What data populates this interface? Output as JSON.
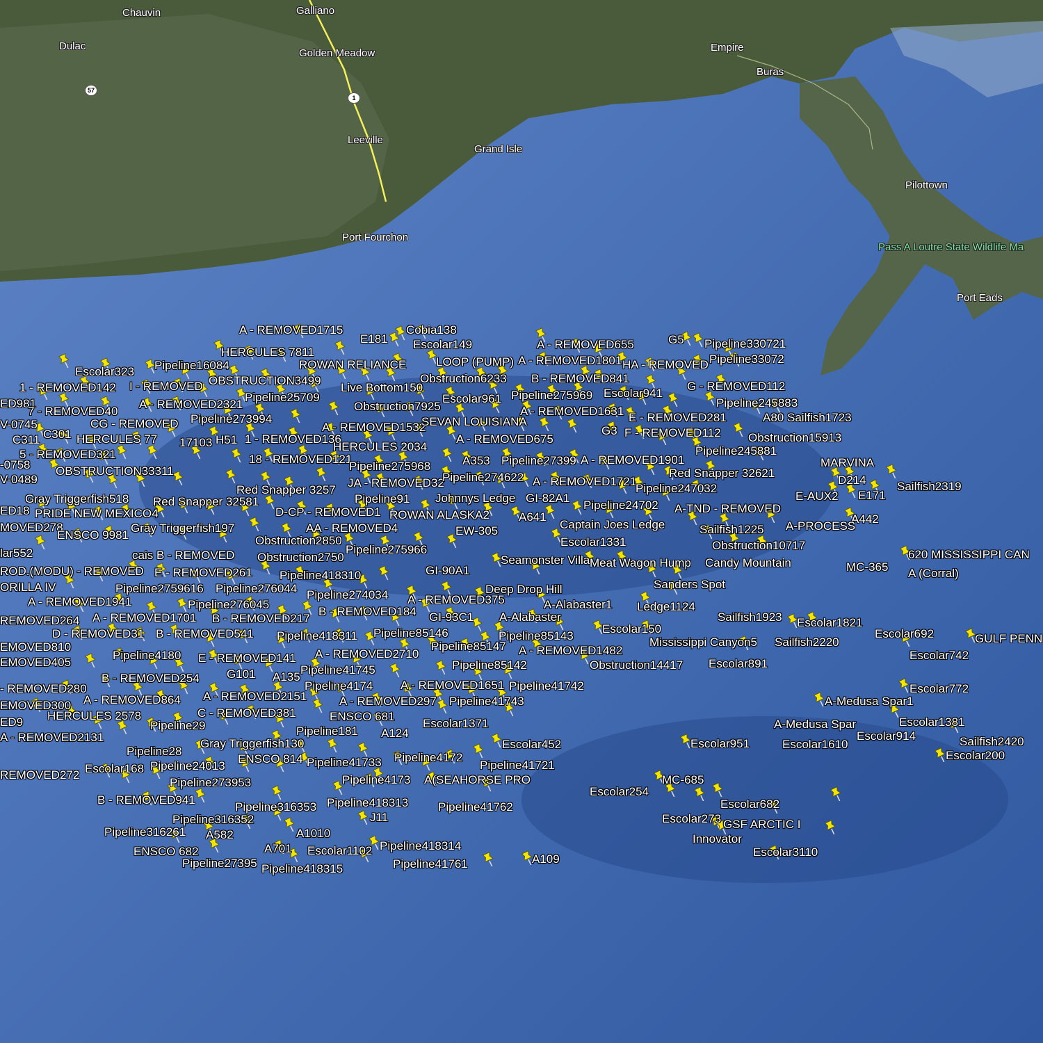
{
  "colors": {
    "pin": "#f2e600",
    "label": "#ffffff",
    "water": "#1e3d7a",
    "land": "#45573a",
    "highway": "#f4ef5a"
  },
  "places": [
    {
      "text": "Chauvin",
      "park": false
    },
    {
      "text": "Galliano",
      "park": false
    },
    {
      "text": "Dulac",
      "park": false
    },
    {
      "text": "Golden Meadow",
      "park": false
    },
    {
      "text": "Empire",
      "park": false
    },
    {
      "text": "Buras",
      "park": false
    },
    {
      "text": "Leeville",
      "park": false
    },
    {
      "text": "Grand Isle",
      "park": false
    },
    {
      "text": "Pilottown",
      "park": false
    },
    {
      "text": "Port Fourchon",
      "park": false
    },
    {
      "text": "Pass A Loutre State Wildlife Ma",
      "park": true
    },
    {
      "text": "Port Eads",
      "park": false
    }
  ],
  "highways": [
    "57",
    "1"
  ],
  "labels": [
    "A - REMOVED1715",
    "E181",
    "Cobia138",
    "Escolar149",
    "A - REMOVED655",
    "G5",
    "Pipeline330721",
    "HERCULES 7811",
    "ROWAN RELIANCE",
    "LOOP (PUMP)",
    "A - REMOVED1801",
    "HA - REMOVED",
    "Pipeline33072",
    "Escolar323",
    "Pipeline16084",
    "OBSTRUCTION3499",
    "Live Bottom150",
    "Obstruction6233",
    "B - REMOVED841",
    "1 - REMOVED142",
    "I - REMOVED",
    "G - REMOVED112",
    "Pipeline25709",
    "Escolar961",
    "Pipeline275969",
    "Escolar941",
    "ED981",
    "A - REMOVED2321",
    "Obstruction7925",
    "Pipeline245883",
    "7 - REMOVED40",
    "A - REMOVED1631",
    "A80",
    "Sailfish1723",
    "V-0745",
    "CG - REMOVED",
    "Pipeline273994",
    "A - REMOVED1532",
    "SEVAN LOUISIANA",
    "E - REMOVED281",
    "C311",
    "C301",
    "HERCULES 77",
    "17103",
    "H51",
    "1 - REMOVED136",
    "G3",
    "F - REMOVED112",
    "Obstruction15913",
    "HERCULES 2034",
    "A - REMOVED675",
    "5 - REMOVED321",
    "Pipeline245881",
    "-0758",
    "18 - REMOVED121",
    "A353",
    "Pipeline27399",
    "A - REMOVED1901",
    "Pipeline275968",
    "MARVINA",
    "OBSTRUCTION33311",
    "Red Snapper 32621",
    "V-0489",
    "JA - REMOVED32",
    "Pipeline274622",
    "A - REMOVED1721",
    "D214",
    "Red Snapper 3257",
    "Sailfish2319",
    "Pipeline247032",
    "Pipeline91",
    "Gray Triggerfish518",
    "Johnnys Ledge",
    "GI-82A1",
    "E-AUX2",
    "E171",
    "Red Snapper 32581",
    "Pipeline24702",
    "A-TND - REMOVED",
    "ED18",
    "D-CP - REMOVED1",
    "ROWAN ALASKA2",
    "PRIDE NEW MEXICO4",
    "A641",
    "Captain Joes Ledge",
    "A442",
    "MOVED278",
    "AA - REMOVED4",
    "A-PROCESS",
    "Sailfish1225",
    "Gray Triggerfish197",
    "EW-305",
    "ENSCO 9981",
    "Escolar1331",
    "Obstruction2850",
    "Obstruction10717",
    "Pipeline275966",
    "lar552",
    "620 MISSISSIPPI CAN",
    "cais B - REMOVED",
    "Obstruction2750",
    "Seamonster Villa",
    "Meat Wagon Hump",
    "Candy Mountain",
    "ROD.(MODU) - REMOVED",
    "E - REMOVED261",
    "MC-365",
    "Pipeline418310",
    "GI-90A1",
    "A (Corral)",
    "Sanders Spot",
    "Pipeline2759616",
    "Pipeline276044",
    "Deep Drop Hill",
    "ORILLA IV",
    "Pipeline274034",
    "A - REMOVED375",
    "A - REMOVED1941",
    "Pipeline276045",
    "A-Alabaster1",
    "Ledge1124",
    "B - REMOVED184",
    "A-Alabaster",
    "REMOVED264",
    "A - REMOVED1701",
    "B - REMOVED217",
    "GI-93C1",
    "Sailfish1923",
    "Escolar1821",
    "Escolar150",
    "D - REMOVED31",
    "B - REMOVED541",
    "Pipeline418311",
    "Pipeline85146",
    "Escolar692",
    "Pipeline85143",
    "Mississippi Canyon5",
    "Sailfish2220",
    "GULF PENN",
    "EMOVED810",
    "Pipeline85147",
    "A - REMOVED1482",
    "Pipeline4180",
    "E - REMOVED141",
    "A - REMOVED2710",
    "Escolar742",
    "EMOVED405",
    "Pipeline85142",
    "Obstruction14417",
    "Escolar891",
    "Pipeline41745",
    "B - REMOVED254",
    "G101",
    "A135",
    "A - REMOVED1651",
    "Escolar772",
    "- REMOVED280",
    "Pipeline4174",
    "Pipeline41742",
    "A - REMOVED864",
    "A - REMOVED2151",
    "A-Medusa Spar1",
    "A - REMOVED297",
    "Pipeline41743",
    "EMOVED300",
    "C - REMOVED381",
    "ED9",
    "HERCULES 2578",
    "ENSCO 681",
    "Escolar1381",
    "Escolar1371",
    "A-Medusa Spar",
    "Pipeline29",
    "A124",
    "Pipeline181",
    "Escolar914",
    "Sailfish2420",
    "A - REMOVED2131",
    "Gray Triggerfish130",
    "Escolar452",
    "Escolar951",
    "Escolar1610",
    "Pipeline28",
    "Escolar200",
    "ENSCO 814",
    "Pipeline4172",
    "Pipeline41733",
    "Escolar168",
    "Pipeline24013",
    "Pipeline41721",
    "REMOVED272",
    "Pipeline4173",
    "A(SEAHORSE PRO",
    "MC-685",
    "Pipeline273953",
    "Escolar254",
    "B - REMOVED941",
    "Escolar682",
    "Pipeline316353",
    "Pipeline418313",
    "Pipeline41762",
    "Escolar273",
    "Pipeline316352",
    "J11",
    "GSF ARCTIC I",
    "Pipeline316261",
    "A582",
    "A1010",
    "Innovator",
    "A701",
    "Escolar1102",
    "Pipeline418314",
    "Escolar3110",
    "ENSCO 682",
    "A109",
    "Pipeline27395",
    "Pipeline418315",
    "Pipeline41761"
  ]
}
